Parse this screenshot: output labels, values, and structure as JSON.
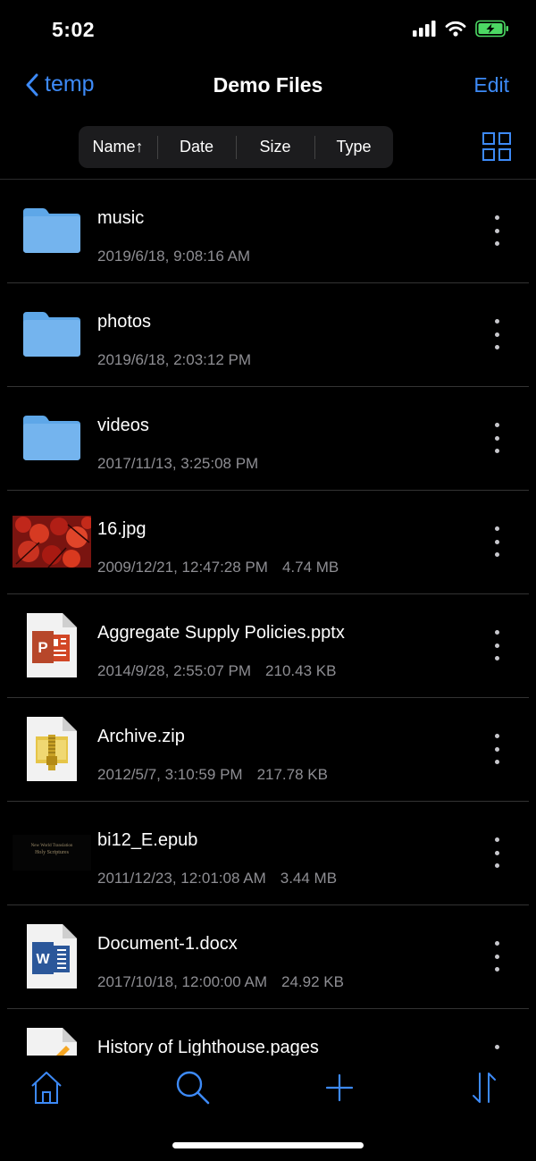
{
  "status": {
    "time": "5:02"
  },
  "nav": {
    "back_label": "temp",
    "title": "Demo Files",
    "edit_label": "Edit"
  },
  "sort": {
    "segments": [
      "Name↑",
      "Date",
      "Size",
      "Type"
    ]
  },
  "files": [
    {
      "name": "music",
      "date": "2019/6/18, 9:08:16 AM",
      "size": "",
      "kind": "folder"
    },
    {
      "name": "photos",
      "date": "2019/6/18, 2:03:12 PM",
      "size": "",
      "kind": "folder"
    },
    {
      "name": "videos",
      "date": "2017/11/13, 3:25:08 PM",
      "size": "",
      "kind": "folder"
    },
    {
      "name": "16.jpg",
      "date": "2009/12/21, 12:47:28 PM",
      "size": "4.74 MB",
      "kind": "image"
    },
    {
      "name": "Aggregate Supply Policies.pptx",
      "date": "2014/9/28, 2:55:07 PM",
      "size": "210.43 KB",
      "kind": "pptx"
    },
    {
      "name": "Archive.zip",
      "date": "2012/5/7, 3:10:59 PM",
      "size": "217.78 KB",
      "kind": "zip"
    },
    {
      "name": "bi12_E.epub",
      "date": "2011/12/23, 12:01:08 AM",
      "size": "3.44 MB",
      "kind": "epub",
      "cover_lines": [
        "New World Translation",
        "Holy Scriptures"
      ]
    },
    {
      "name": "Document-1.docx",
      "date": "2017/10/18, 12:00:00 AM",
      "size": "24.92 KB",
      "kind": "docx"
    },
    {
      "name": "History of Lighthouse.pages",
      "date": "",
      "size": "",
      "kind": "pages"
    }
  ],
  "tabs": [
    {
      "icon": "home-icon"
    },
    {
      "icon": "search-icon"
    },
    {
      "icon": "plus-icon"
    },
    {
      "icon": "sort-arrows-icon"
    }
  ],
  "colors": {
    "accent": "#3d8af7",
    "folder": "#74b4ee",
    "secondary_text": "#8e8e93",
    "battery": "#4cd964"
  }
}
